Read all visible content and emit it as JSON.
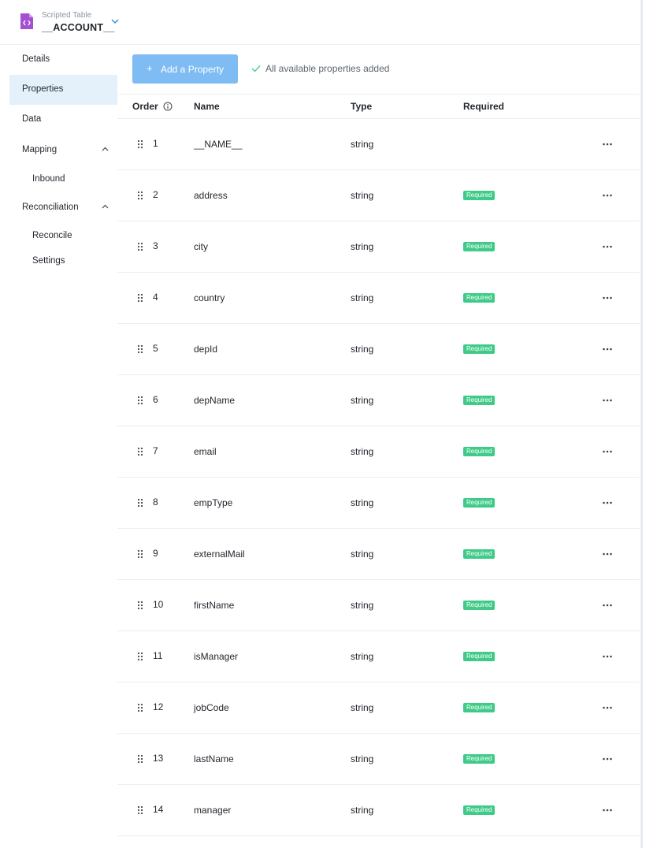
{
  "header": {
    "subtitle": "Scripted Table",
    "title": "__ACCOUNT__"
  },
  "sidebar": {
    "details": "Details",
    "properties": "Properties",
    "data": "Data",
    "mapping": "Mapping",
    "inbound": "Inbound",
    "reconciliation": "Reconciliation",
    "reconcile": "Reconcile",
    "settings": "Settings"
  },
  "toolbar": {
    "add_plus": "+",
    "add_label": "Add a Property",
    "status": "All available properties added"
  },
  "table": {
    "columns": {
      "order": "Order",
      "name": "Name",
      "type": "Type",
      "required": "Required"
    },
    "rows": [
      {
        "order": "1",
        "name": "__NAME__",
        "type": "string",
        "required": ""
      },
      {
        "order": "2",
        "name": "address",
        "type": "string",
        "required": "Required"
      },
      {
        "order": "3",
        "name": "city",
        "type": "string",
        "required": "Required"
      },
      {
        "order": "4",
        "name": "country",
        "type": "string",
        "required": "Required"
      },
      {
        "order": "5",
        "name": "depId",
        "type": "string",
        "required": "Required"
      },
      {
        "order": "6",
        "name": "depName",
        "type": "string",
        "required": "Required"
      },
      {
        "order": "7",
        "name": "email",
        "type": "string",
        "required": "Required"
      },
      {
        "order": "8",
        "name": "empType",
        "type": "string",
        "required": "Required"
      },
      {
        "order": "9",
        "name": "externalMail",
        "type": "string",
        "required": "Required"
      },
      {
        "order": "10",
        "name": "firstName",
        "type": "string",
        "required": "Required"
      },
      {
        "order": "11",
        "name": "isManager",
        "type": "string",
        "required": "Required"
      },
      {
        "order": "12",
        "name": "jobCode",
        "type": "string",
        "required": "Required"
      },
      {
        "order": "13",
        "name": "lastName",
        "type": "string",
        "required": "Required"
      },
      {
        "order": "14",
        "name": "manager",
        "type": "string",
        "required": "Required"
      }
    ]
  },
  "colors": {
    "accent": "#7fbcf3",
    "active_nav": "#e4f1fb",
    "required_badge": "#3fcb87",
    "file_icon": "#a54fd1"
  }
}
